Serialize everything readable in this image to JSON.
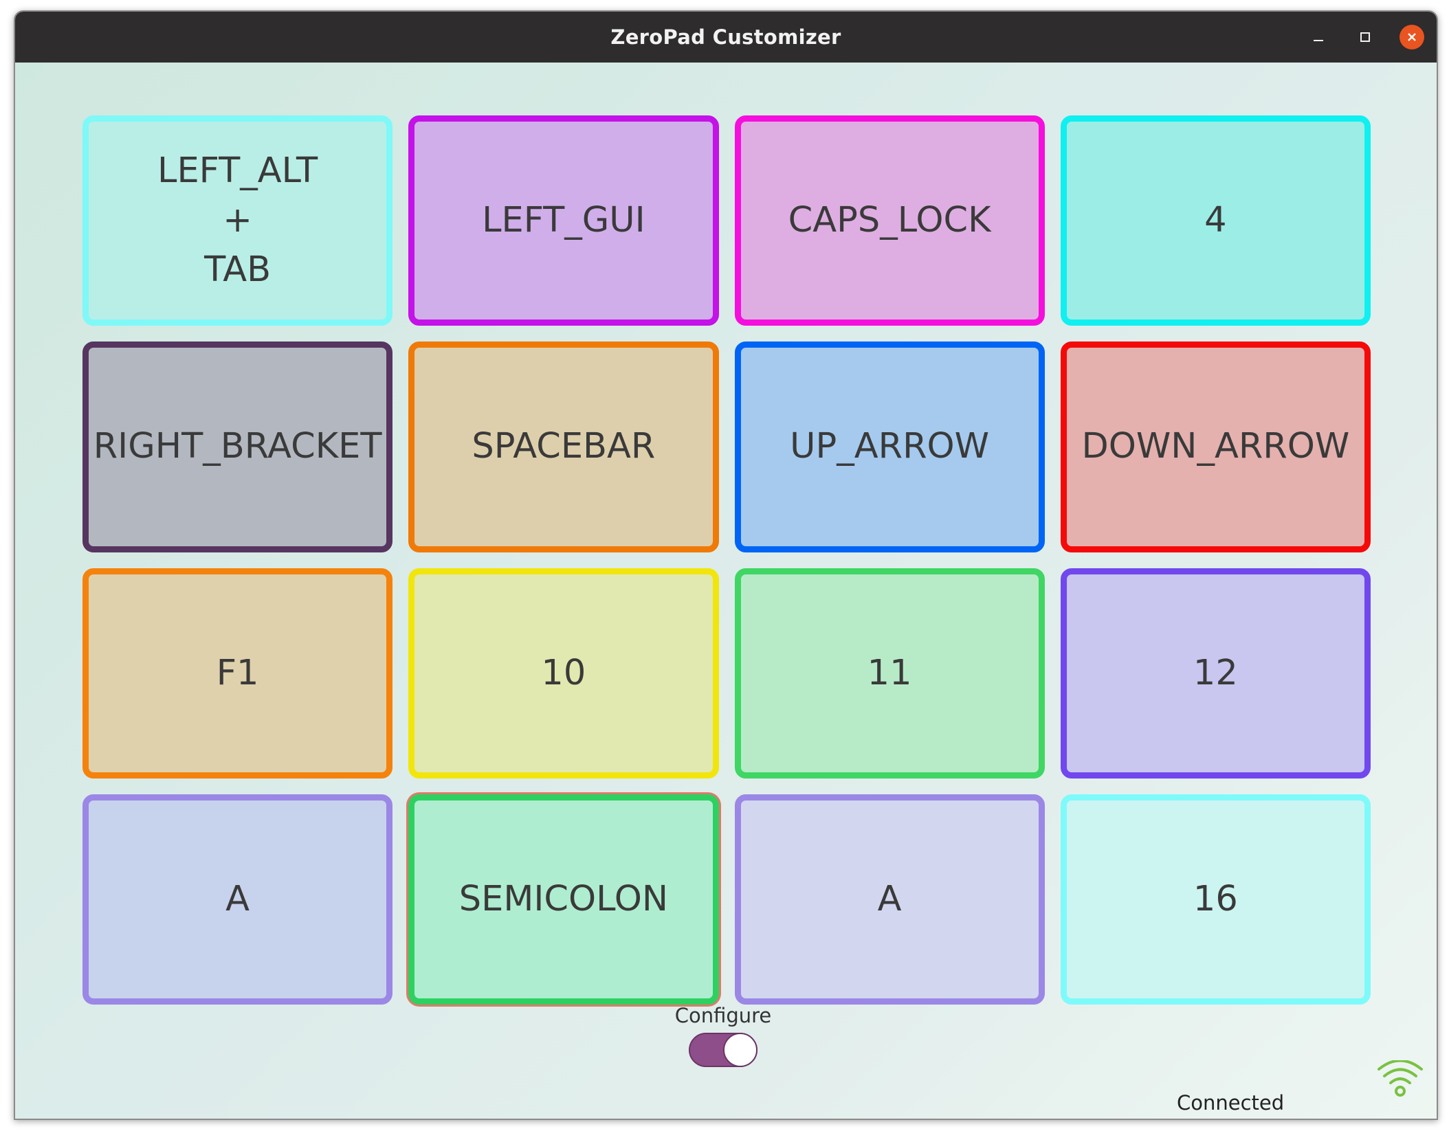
{
  "window": {
    "title": "ZeroPad Customizer",
    "controls": {
      "minimize_icon": "minimize-icon",
      "maximize_icon": "maximize-icon",
      "close_icon": "close-icon"
    }
  },
  "keys": [
    {
      "label": "LEFT_ALT\n+\nTAB",
      "border": "#7ff8f8",
      "fill": "#b9eee7"
    },
    {
      "label": "LEFT_GUI",
      "border": "#c412e8",
      "fill": "#d0aeea"
    },
    {
      "label": "CAPS_LOCK",
      "border": "#f50fdd",
      "fill": "#deaee2"
    },
    {
      "label": "4",
      "border": "#10f0f0",
      "fill": "#9cede6"
    },
    {
      "label": "RIGHT_BRACKET",
      "border": "#563560",
      "fill": "#b3b8c0"
    },
    {
      "label": "SPACEBAR",
      "border": "#f07a08",
      "fill": "#decfac"
    },
    {
      "label": "UP_ARROW",
      "border": "#0064f5",
      "fill": "#a5caee"
    },
    {
      "label": "DOWN_ARROW",
      "border": "#f50a0a",
      "fill": "#e4b1ae"
    },
    {
      "label": "F1",
      "border": "#f5820c",
      "fill": "#dfd1ac"
    },
    {
      "label": "10",
      "border": "#f2e50c",
      "fill": "#e1e9b0"
    },
    {
      "label": "11",
      "border": "#3fd664",
      "fill": "#b7ebc8"
    },
    {
      "label": "12",
      "border": "#7048ee",
      "fill": "#c9c6f0"
    },
    {
      "label": "A",
      "border": "#9b87e6",
      "fill": "#c7d2ec"
    },
    {
      "label": "SEMICOLON",
      "border": "#2ed161",
      "fill": "#afedd0",
      "selected": true
    },
    {
      "label": "A",
      "border": "#9b87e6",
      "fill": "#d2d7ef"
    },
    {
      "label": "16",
      "border": "#7ffafa",
      "fill": "#ccf5f1"
    }
  ],
  "configure": {
    "label": "Configure",
    "toggle_on": true,
    "toggle_color": "#8e4e8a"
  },
  "status": {
    "text": "Connected",
    "icon": "wifi-icon",
    "icon_color": "#7ac143"
  }
}
